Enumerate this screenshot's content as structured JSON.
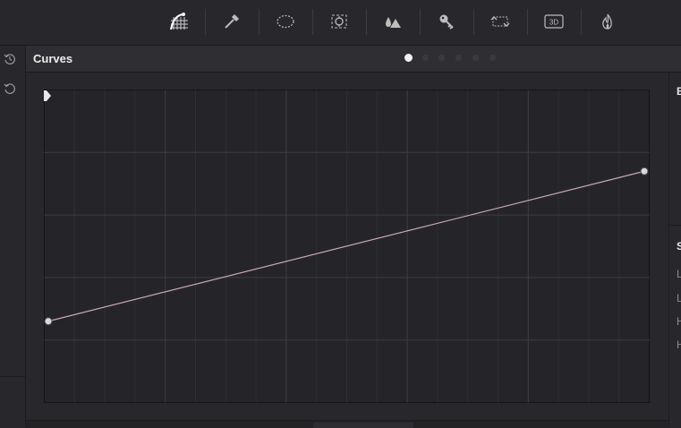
{
  "toolbar": {
    "tools": [
      {
        "name": "curves-tool-icon",
        "active": true
      },
      {
        "name": "qualifier-eyedropper-icon",
        "active": false
      },
      {
        "name": "power-window-icon",
        "active": false
      },
      {
        "name": "tracker-icon",
        "active": false
      },
      {
        "name": "blur-icon",
        "active": false
      },
      {
        "name": "key-icon",
        "active": false
      },
      {
        "name": "sizing-icon",
        "active": false
      },
      {
        "name": "3d-icon",
        "active": false,
        "label": "3D"
      },
      {
        "name": "fx-icon",
        "active": false
      }
    ]
  },
  "left_strip": {
    "icons": [
      "history-icon",
      "reset-icon"
    ]
  },
  "panel": {
    "title": "Curves",
    "pages_total": 6,
    "page_active": 1
  },
  "curve": {
    "points": [
      {
        "x": 0.0,
        "y": 0.26
      },
      {
        "x": 1.0,
        "y": 0.74
      }
    ],
    "line_color": "#c9a9b1"
  },
  "right_panel": {
    "header_1": "B",
    "header_2": "S",
    "items": [
      "L",
      "L",
      "H",
      "H"
    ]
  },
  "colors": {
    "background": "#28282c",
    "header": "#2f2f33",
    "grid": "#3c3c40",
    "curve": "#c9a9b1"
  }
}
